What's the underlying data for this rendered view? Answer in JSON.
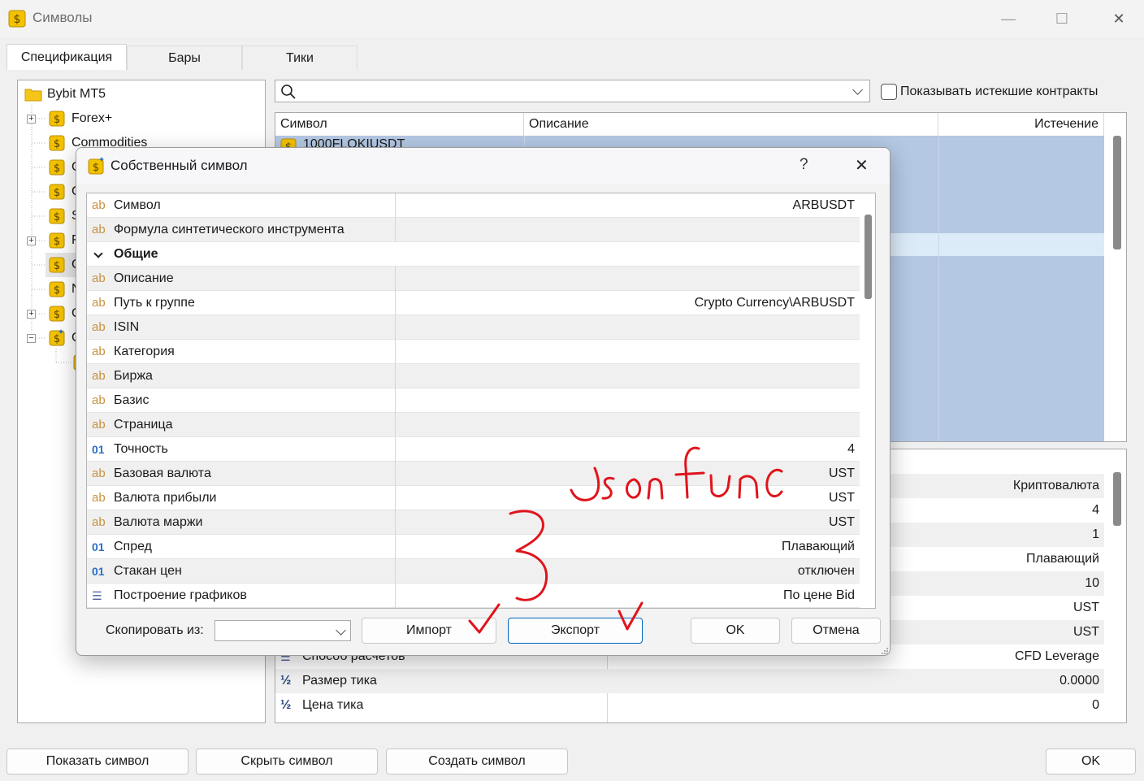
{
  "window": {
    "title": "Символы",
    "controls": {
      "minimize": "—",
      "maximize": "☐",
      "close": "✕"
    }
  },
  "tabs": [
    {
      "label": "Спецификация"
    },
    {
      "label": "Бары"
    },
    {
      "label": "Тики"
    }
  ],
  "tree": {
    "root": "Bybit MT5",
    "items": [
      {
        "label": "Forex+"
      },
      {
        "label": "Commodities"
      },
      {
        "label": "C"
      },
      {
        "label": "C"
      },
      {
        "label": "S"
      },
      {
        "label": "F"
      },
      {
        "label": "C"
      },
      {
        "label": "N"
      },
      {
        "label": "C"
      },
      {
        "label": "C"
      }
    ]
  },
  "search": {
    "placeholder": ""
  },
  "show_expired": {
    "label": "Показывать истекшие контракты",
    "checked": false
  },
  "symbols_table": {
    "headers": [
      "Символ",
      "Описание",
      "Истечение"
    ],
    "first_row_symbol": "1000FLOKIUSDT"
  },
  "details_table": {
    "rows": [
      {
        "label": "",
        "value": "Криптовалюта"
      },
      {
        "label": "",
        "value": "4"
      },
      {
        "label": "",
        "value": "1"
      },
      {
        "label": "",
        "value": "Плавающий"
      },
      {
        "label": "",
        "value": "10"
      },
      {
        "label": "",
        "value": "UST"
      },
      {
        "label": "",
        "value": "UST"
      },
      {
        "label": "Способ расчетов",
        "value": "CFD Leverage"
      },
      {
        "label": "Размер тика",
        "value": "0.0000"
      },
      {
        "label": "Цена тика",
        "value": "0"
      }
    ]
  },
  "bottom_buttons": {
    "show": "Показать символ",
    "hide": "Скрыть символ",
    "create": "Создать символ",
    "ok": "OK"
  },
  "dialog": {
    "title": "Собственный символ",
    "help": "?",
    "close": "✕",
    "properties": [
      {
        "type": "ab",
        "name": "Символ",
        "value": "ARBUSDT"
      },
      {
        "type": "ab",
        "name": "Формула синтетического инструмента",
        "value": ""
      },
      {
        "type": "group",
        "name": "Общие",
        "value": ""
      },
      {
        "type": "ab",
        "name": "Описание",
        "value": ""
      },
      {
        "type": "ab",
        "name": "Путь к группе",
        "value": "Crypto Currency\\ARBUSDT"
      },
      {
        "type": "ab",
        "name": "ISIN",
        "value": ""
      },
      {
        "type": "ab",
        "name": "Категория",
        "value": ""
      },
      {
        "type": "ab",
        "name": "Биржа",
        "value": ""
      },
      {
        "type": "ab",
        "name": "Базис",
        "value": ""
      },
      {
        "type": "ab",
        "name": "Страница",
        "value": ""
      },
      {
        "type": "num",
        "name": "Точность",
        "value": "4"
      },
      {
        "type": "ab",
        "name": "Базовая валюта",
        "value": "UST"
      },
      {
        "type": "ab",
        "name": "Валюта прибыли",
        "value": "UST"
      },
      {
        "type": "ab",
        "name": "Валюта маржи",
        "value": "UST"
      },
      {
        "type": "num",
        "name": "Спред",
        "value": "Плавающий"
      },
      {
        "type": "num",
        "name": "Стакан цен",
        "value": "отключен"
      },
      {
        "type": "list",
        "name": "Построение графиков",
        "value": "По цене Bid"
      }
    ],
    "copy_from_label": "Скопировать из:",
    "copy_from_value": "",
    "import": "Импорт",
    "export": "Экспорт",
    "ok": "OK",
    "cancel": "Отмена"
  },
  "annotations": {
    "handwritten_text": "Json func",
    "number": "3",
    "color": "#e0141c"
  },
  "colors": {
    "selection": "#b4c8e4",
    "selection_light": "#dcebf8",
    "accent": "#0067c0",
    "coin": "#f2c200"
  }
}
